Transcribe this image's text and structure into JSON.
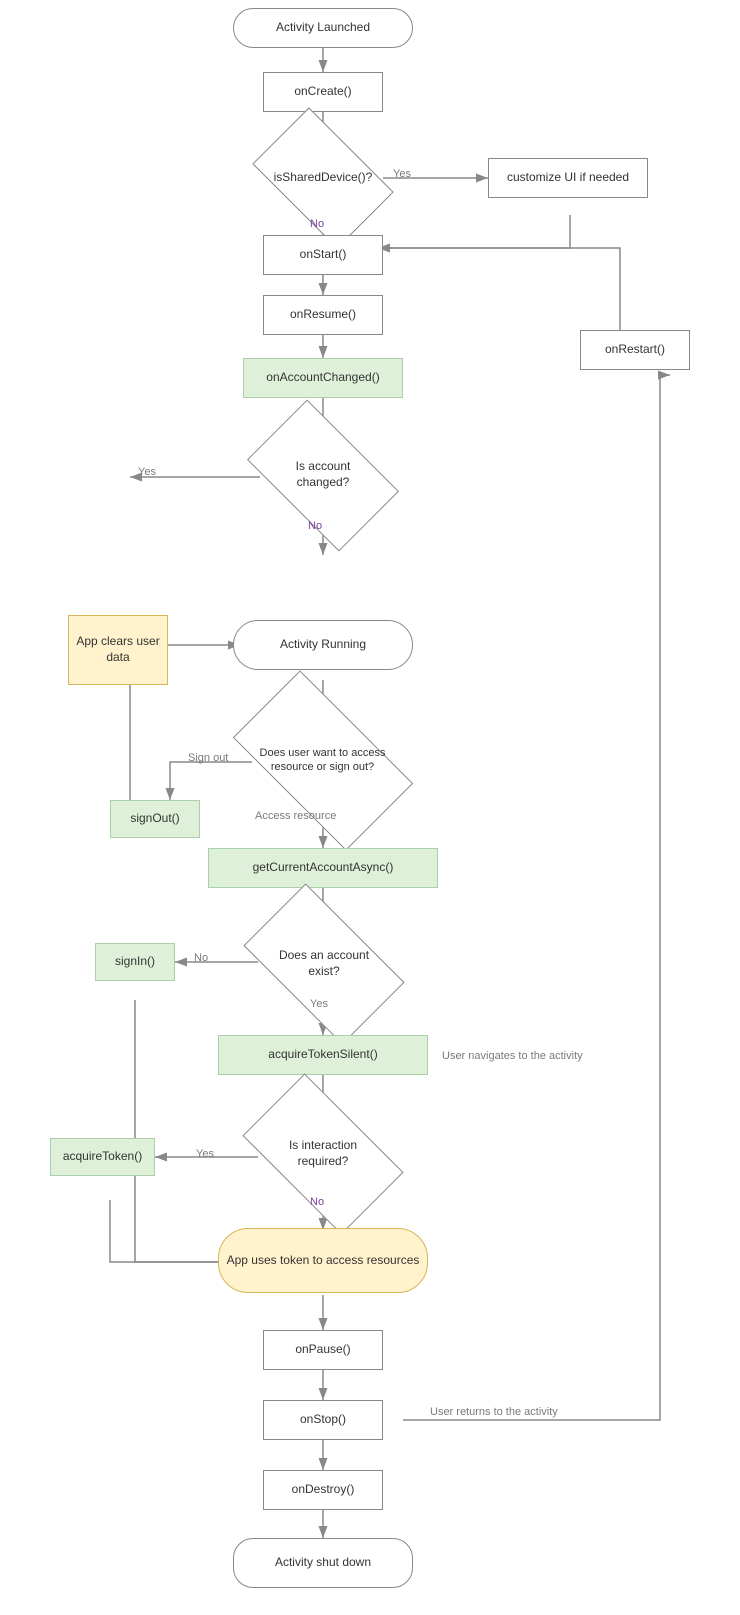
{
  "nodes": {
    "activity_launched": {
      "label": "Activity Launched"
    },
    "on_create": {
      "label": "onCreate()"
    },
    "is_shared": {
      "label": "isSharedDevice()?"
    },
    "customize": {
      "label": "customize UI if needed"
    },
    "on_start": {
      "label": "onStart()"
    },
    "on_resume": {
      "label": "onResume()"
    },
    "on_restart": {
      "label": "onRestart()"
    },
    "on_account_changed": {
      "label": "onAccountChanged()"
    },
    "is_account_changed": {
      "label": "Is account changed?"
    },
    "app_clears": {
      "label": "App clears user data"
    },
    "activity_running": {
      "label": "Activity Running"
    },
    "sign_out_q": {
      "label": "Does user want to access resource or sign out?"
    },
    "sign_out": {
      "label": "signOut()"
    },
    "get_current": {
      "label": "getCurrentAccountAsync()"
    },
    "does_account_exist": {
      "label": "Does an account exist?"
    },
    "sign_in": {
      "label": "signIn()"
    },
    "acquire_silent": {
      "label": "acquireTokenSilent()"
    },
    "is_interaction": {
      "label": "Is interaction required?"
    },
    "acquire_token": {
      "label": "acquireToken()"
    },
    "app_uses_token": {
      "label": "App uses token to access resources"
    },
    "on_pause": {
      "label": "onPause()"
    },
    "on_stop": {
      "label": "onStop()"
    },
    "on_destroy": {
      "label": "onDestroy()"
    },
    "activity_shutdown": {
      "label": "Activity shut down"
    }
  },
  "arrow_labels": {
    "yes1": "Yes",
    "no1": "No",
    "yes2": "Yes",
    "no2": "No",
    "sign_out_label": "Sign out",
    "access_resource": "Access resource",
    "no3": "No",
    "yes3": "Yes",
    "no4": "No",
    "user_returns": "User returns to the activity",
    "user_navigates": "User navigates to the activity"
  },
  "colors": {
    "green_bg": "#dff0d8",
    "green_border": "#aacfaa",
    "yellow_bg": "#fff2cc",
    "yellow_border": "#d6b656",
    "arrow": "#888888",
    "purple": "#7b3fa0"
  }
}
